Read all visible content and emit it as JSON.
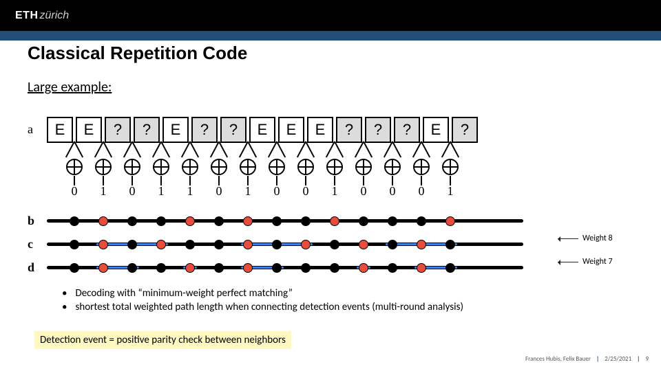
{
  "logo": {
    "eth": "ETH",
    "zurich": "zürich"
  },
  "title": "Classical Repetition Code",
  "subtitle": "Large example:",
  "row_labels": {
    "a": "a",
    "b": "b",
    "c": "c",
    "d": "d"
  },
  "boxes": [
    "E",
    "E",
    "?",
    "?",
    "E",
    "?",
    "?",
    "E",
    "E",
    "E",
    "?",
    "?",
    "?",
    "E",
    "?"
  ],
  "bits": [
    "0",
    "1",
    "0",
    "1",
    "1",
    "0",
    "1",
    "0",
    "0",
    "1",
    "0",
    "0",
    "0",
    "1"
  ],
  "tracks": {
    "b": {
      "dots": [
        "black",
        "red",
        "black",
        "black",
        "red",
        "black",
        "red",
        "black",
        "black",
        "red",
        "black",
        "black",
        "black",
        "red"
      ],
      "blues": []
    },
    "c": {
      "dots": [
        "black",
        "red",
        "black",
        "red",
        "black",
        "black",
        "red",
        "black",
        "red",
        "black",
        "red",
        "black",
        "red",
        "black"
      ],
      "blues": [
        [
          1,
          3
        ],
        [
          6,
          8
        ],
        [
          11,
          13
        ]
      ]
    },
    "d": {
      "dots": [
        "black",
        "red",
        "black",
        "black",
        "red",
        "black",
        "red",
        "black",
        "black",
        "black",
        "red",
        "black",
        "red",
        "black"
      ],
      "blues": [
        [
          1,
          2
        ],
        [
          4,
          4
        ],
        [
          6,
          7
        ],
        [
          10,
          10
        ],
        [
          12,
          13
        ]
      ]
    }
  },
  "weights": {
    "c": "Weight 8",
    "d": "Weight 7"
  },
  "bullets": [
    "Decoding with “minimum-weight perfect matching”",
    "shortest total weighted path length when connecting detection events (multi-round analysis)"
  ],
  "highlight": "Detection event = positive parity check between neighbors",
  "footer": {
    "authors": "Frances Hubis, Felix Bauer",
    "date": "2/25/2021",
    "page": "9"
  },
  "chart_data": {
    "type": "table",
    "title": "Classical Repetition Code large example",
    "row_a_boxes": [
      "E",
      "E",
      "?",
      "?",
      "E",
      "?",
      "?",
      "E",
      "E",
      "E",
      "?",
      "?",
      "?",
      "E",
      "?"
    ],
    "xor_bits": [
      0,
      1,
      0,
      1,
      1,
      0,
      1,
      0,
      0,
      1,
      0,
      0,
      0,
      1
    ],
    "tracks": {
      "b": [
        "black",
        "red",
        "black",
        "black",
        "red",
        "black",
        "red",
        "black",
        "black",
        "red",
        "black",
        "black",
        "black",
        "red"
      ],
      "c": [
        "black",
        "red",
        "black",
        "red",
        "black",
        "black",
        "red",
        "black",
        "red",
        "black",
        "red",
        "black",
        "red",
        "black"
      ],
      "d": [
        "black",
        "red",
        "black",
        "black",
        "red",
        "black",
        "red",
        "black",
        "black",
        "black",
        "red",
        "black",
        "red",
        "black"
      ]
    },
    "weights": {
      "c": 8,
      "d": 7
    }
  }
}
